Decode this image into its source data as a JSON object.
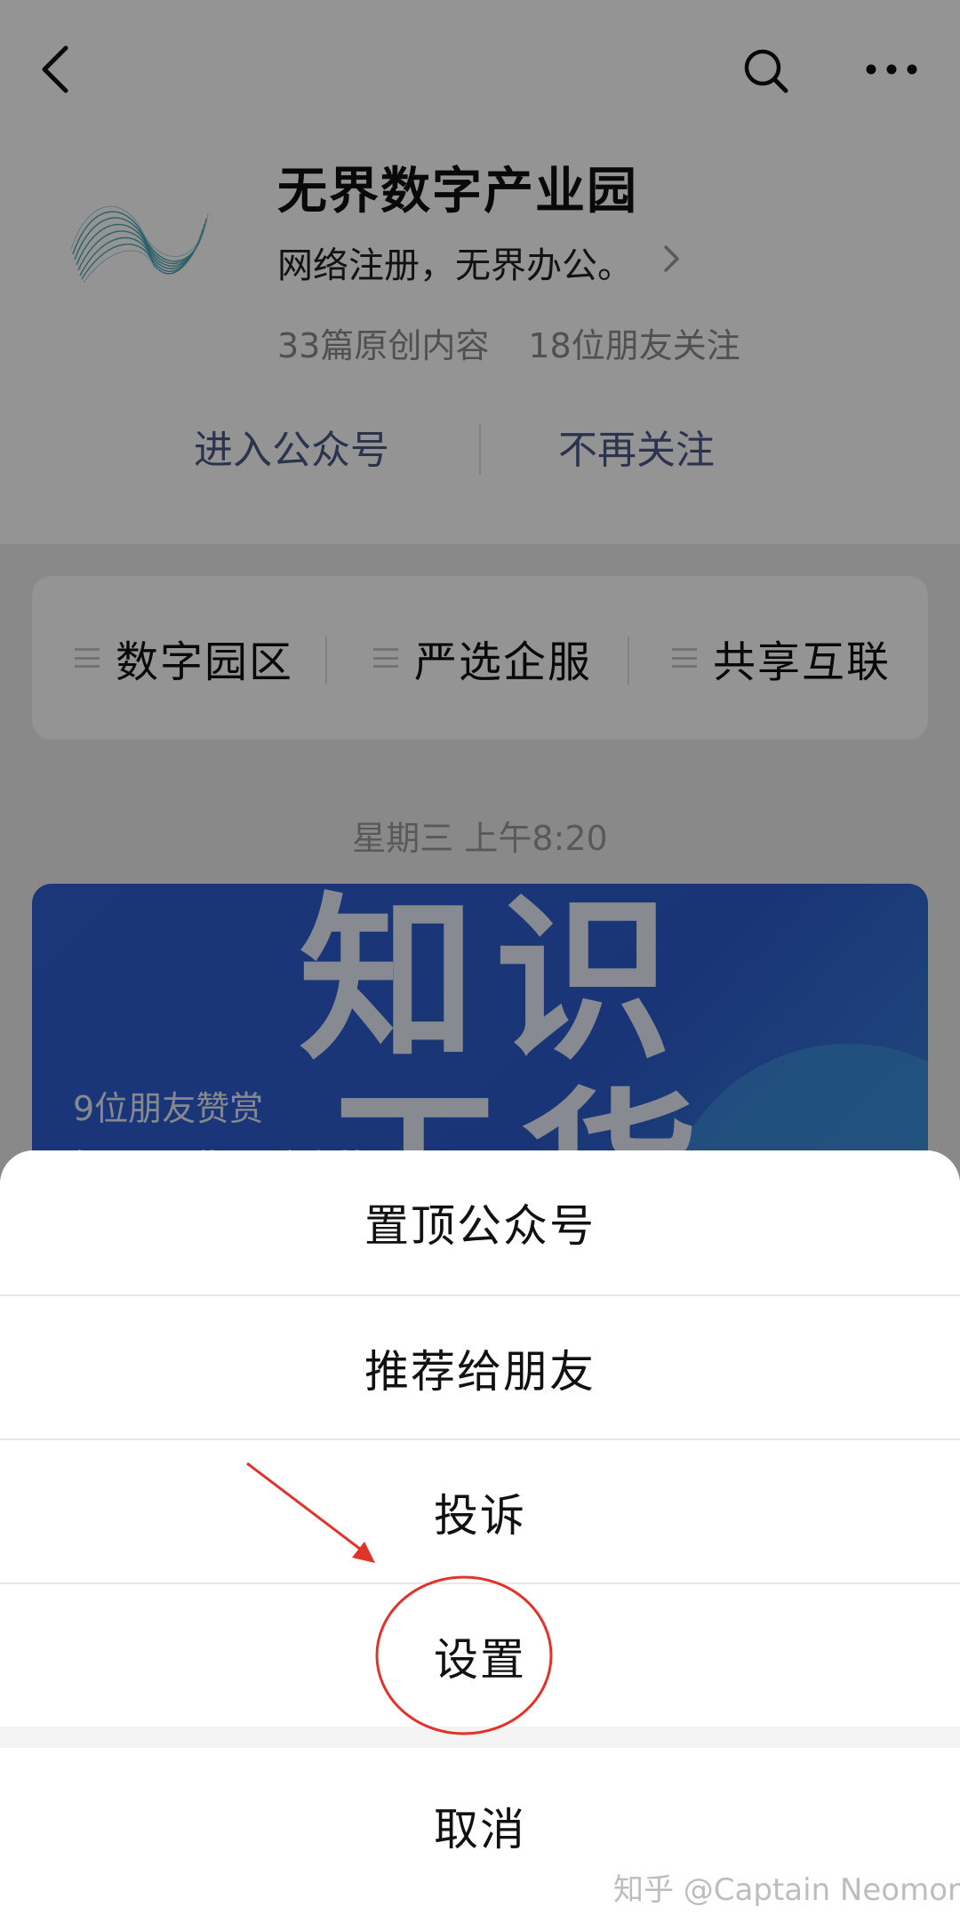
{
  "account": {
    "name": "无界数字产业园",
    "description": "网络注册，无界办公。",
    "stats": {
      "original_content": "33篇原创内容",
      "friends_following": "18位朋友关注"
    },
    "actions": {
      "enter": "进入公众号",
      "unfollow": "不再关注"
    }
  },
  "menu": [
    {
      "label": "数字园区"
    },
    {
      "label": "严选企服"
    },
    {
      "label": "共享互联"
    }
  ],
  "timestamp": "星期三 上午8:20",
  "article": {
    "cover_text_line1": "知识",
    "cover_text_line2": "干货",
    "likes": "9位朋友赞赏",
    "title": "知识干货 | 案例解读：公司注册不得不..."
  },
  "action_sheet": {
    "options": [
      {
        "label": "置顶公众号"
      },
      {
        "label": "推荐给朋友"
      },
      {
        "label": "投诉"
      },
      {
        "label": "设置"
      }
    ],
    "cancel": "取消"
  },
  "watermark": "知乎 @Captain Neomore",
  "colors": {
    "link": "#4a5a84",
    "annotation": "#e0332a",
    "article_bg": "#2f5fd1"
  },
  "icons": [
    "back-icon",
    "search-icon",
    "more-icon",
    "chevron-right-icon",
    "menu-icon"
  ]
}
